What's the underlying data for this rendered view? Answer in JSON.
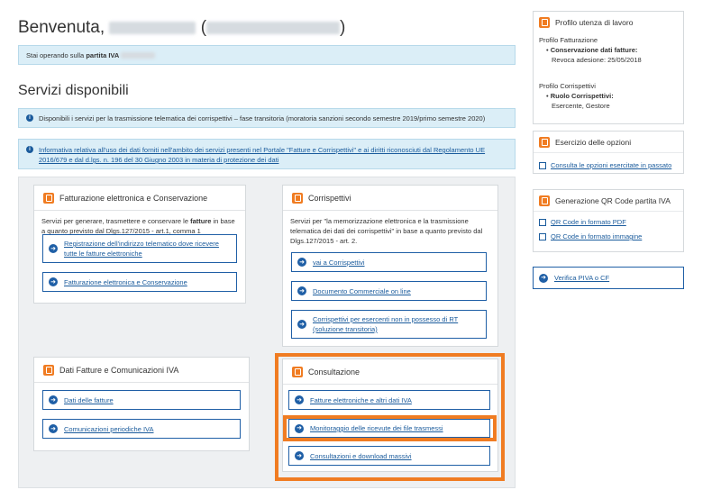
{
  "header": {
    "greeting": "Benvenuta,",
    "paren_open": "(",
    "paren_close": ")"
  },
  "operating_notice": {
    "text_prefix": "Stai operando sulla",
    "bold_label": "partita IVA"
  },
  "services": {
    "title": "Servizi disponibili",
    "info_notice": "Disponibili i servizi per la trasmissione telematica dei corrispettivi – fase transitoria (moratoria sanzioni secondo semestre 2019/primo semestre 2020)",
    "privacy_link": "Informativa relativa all'uso dei dati forniti nell'ambito dei servizi presenti nel Portale \"Fatture e Corrispettivi\" e ai diritti riconosciuti dal Regolamento UE 2016/679 e dal d.lgs. n. 196 del 30 Giugno 2003 in materia di protezione dei dati"
  },
  "cards": {
    "fatturazione": {
      "title": "Fatturazione elettronica e Conservazione",
      "desc_a": "Servizi per generare, trasmettere e conservare le",
      "desc_bold": "fatture",
      "desc_b": "in base a quanto previsto dal Dlgs.127/2015 - art.1, comma 1",
      "buttons": [
        "Registrazione dell'indirizzo telematico dove ricevere tutte le fatture elettroniche",
        "Fatturazione elettronica e Conservazione"
      ]
    },
    "corrispettivi": {
      "title": "Corrispettivi",
      "desc": "Servizi per \"la memorizzazione elettronica e la trasmissione telematica dei dati dei corrispettivi\" in base a quanto previsto dal Dlgs.127/2015 - art. 2.",
      "buttons": [
        "vai a Corrispettivi",
        "Documento Commerciale on line",
        "Corrispettivi per esercenti non in possesso di RT (soluzione transitoria)"
      ]
    },
    "dati_fatture": {
      "title": "Dati Fatture e Comunicazioni IVA",
      "buttons": [
        "Dati delle fatture",
        "Comunicazioni periodiche IVA"
      ]
    },
    "consultazione": {
      "title": "Consultazione",
      "buttons": [
        "Fatture elettroniche e altri dati IVA",
        "Monitoraggio delle ricevute dei file trasmessi",
        "Consultazioni e download massivi"
      ]
    }
  },
  "sidebar": {
    "profile": {
      "title": "Profilo utenza di lavoro",
      "section1_title": "Profilo Fatturazione",
      "section1_item": "Conservazione dati fatture:",
      "section1_sub": "Revoca adesione: 25/05/2018",
      "section2_title": "Profilo Corrispettivi",
      "section2_item": "Ruolo Corrispettivi:",
      "section2_sub": "Esercente, Gestore"
    },
    "options": {
      "title": "Esercizio delle opzioni",
      "link": "Consulta le opzioni esercitate in passato"
    },
    "qr": {
      "title": "Generazione QR Code partita IVA",
      "link_pdf": "QR Code in formato PDF",
      "link_img": "QR Code in formato immagine"
    },
    "verify": {
      "label": "Verifica PIVA o CF"
    }
  },
  "colors": {
    "accent_orange": "#f07c22",
    "link_blue": "#1a5b9c",
    "info_bg": "#dbeef7"
  }
}
